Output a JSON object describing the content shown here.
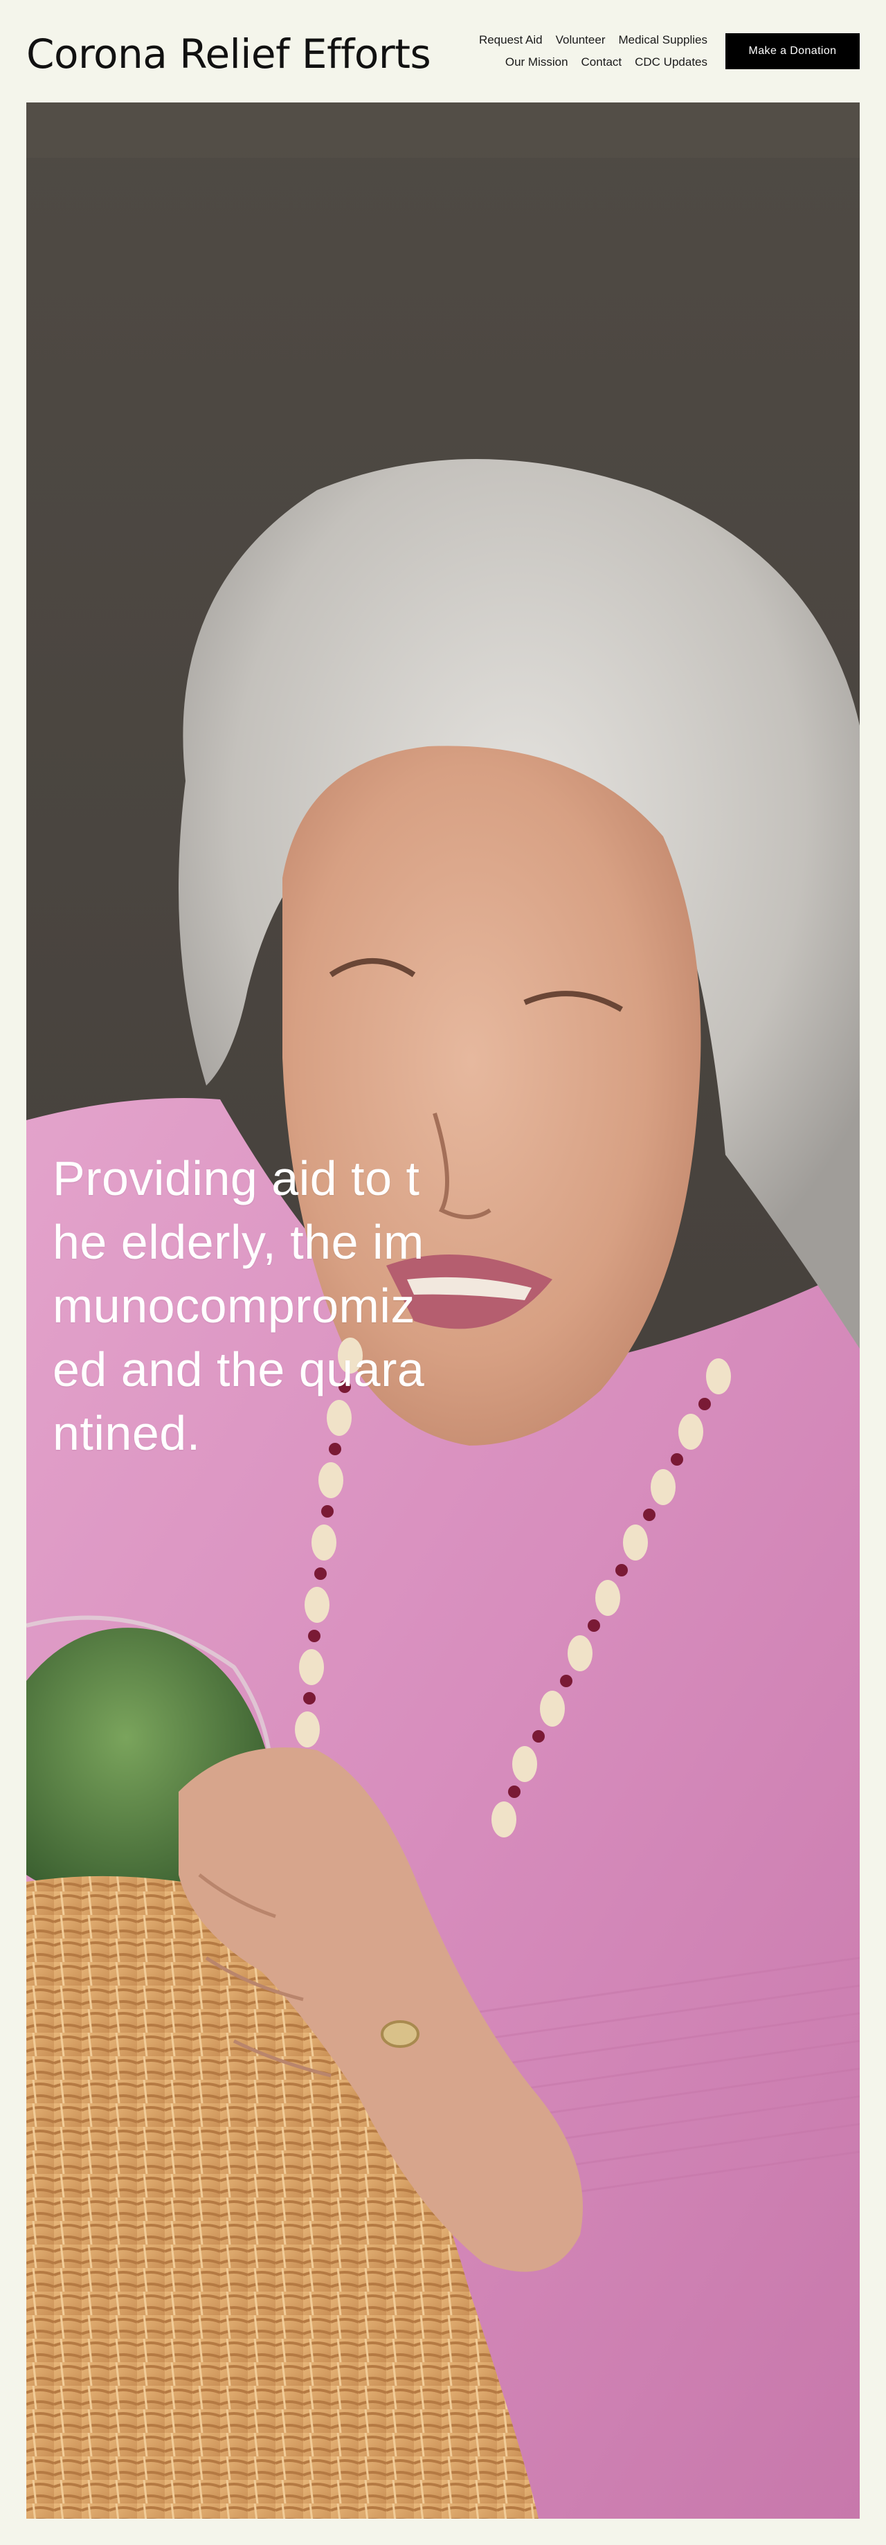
{
  "header": {
    "site_title": "Corona Relief Efforts",
    "nav": {
      "row1": [
        {
          "label": "Request Aid"
        },
        {
          "label": "Volunteer"
        },
        {
          "label": "Medical Supplies"
        }
      ],
      "row2": [
        {
          "label": "Our Mission"
        },
        {
          "label": "Contact"
        },
        {
          "label": "CDC Updates"
        }
      ]
    },
    "cta_label": "Make a Donation"
  },
  "hero": {
    "heading": "Providing aid to the elderly, the immunocompromized and the quarantined.",
    "colors": {
      "background_wall": "#4a443e",
      "sweater": "#d98fbf",
      "hair": "#c9c7c3",
      "skin": "#d9a88f",
      "basket": "#d9a66b"
    }
  },
  "colors": {
    "page_background": "#f4f5eb",
    "text": "#111111",
    "button_bg": "#000000",
    "button_text": "#ffffff"
  }
}
